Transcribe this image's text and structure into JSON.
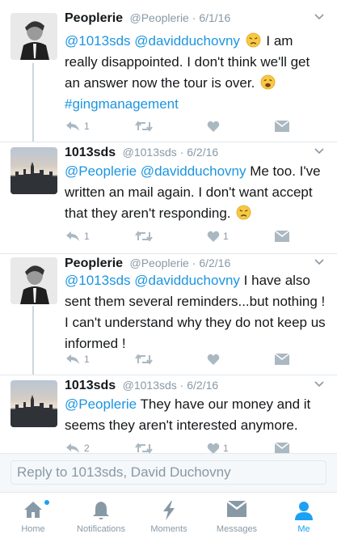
{
  "tweets": [
    {
      "name": "Peoplerie",
      "handle": "@Peoplerie",
      "date": "6/1/16",
      "avatar_icon": "man-portrait-avatar",
      "body_parts": [
        {
          "text": "@1013sds @davidduchovny",
          "style": "mention"
        },
        {
          "emoji": "disappointed-face-emoji"
        },
        {
          "text": "I am really disappointed. I don't think we'll get an answer now the tour is over.",
          "style": "plain"
        },
        {
          "emoji": "weary-face-emoji"
        },
        {
          "text": "#gingmanagement",
          "style": "mention"
        }
      ],
      "reply_count": "1",
      "retweet_count": "",
      "like_count": ""
    },
    {
      "name": "1013sds",
      "handle": "@1013sds",
      "date": "6/2/16",
      "avatar_icon": "city-skyline-avatar",
      "body_parts": [
        {
          "text": "@Peoplerie @davidduchovny",
          "style": "mention"
        },
        {
          "text": "Me too. I've written an mail again. I don't want accept that they aren't responding.",
          "style": "plain"
        },
        {
          "emoji": "disappointed-face-emoji"
        }
      ],
      "reply_count": "1",
      "retweet_count": "",
      "like_count": "1"
    },
    {
      "name": "Peoplerie",
      "handle": "@Peoplerie",
      "date": "6/2/16",
      "avatar_icon": "man-portrait-avatar",
      "body_parts": [
        {
          "text": "@1013sds @davidduchovny",
          "style": "mention"
        },
        {
          "text": "I have also sent them several reminders...but nothing ! I can't understand why they do not keep us informed !",
          "style": "plain"
        }
      ],
      "reply_count": "1",
      "retweet_count": "",
      "like_count": ""
    },
    {
      "name": "1013sds",
      "handle": "@1013sds",
      "date": "6/2/16",
      "avatar_icon": "city-skyline-avatar",
      "body_parts": [
        {
          "text": "@Peoplerie",
          "style": "mention"
        },
        {
          "text": " They have our money and it seems they aren't interested anymore.",
          "style": "plain"
        }
      ],
      "reply_count": "2",
      "retweet_count": "",
      "like_count": "1"
    }
  ],
  "meta_separator": "·",
  "reply_bar": {
    "placeholder": "Reply to 1013sds, David Duchovny"
  },
  "tabs": [
    {
      "label": "Home",
      "icon": "home-icon",
      "active": false,
      "has_dot": true
    },
    {
      "label": "Notifications",
      "icon": "bell-icon",
      "active": false,
      "has_dot": false
    },
    {
      "label": "Moments",
      "icon": "lightning-icon",
      "active": false,
      "has_dot": false
    },
    {
      "label": "Messages",
      "icon": "envelope-icon",
      "active": false,
      "has_dot": false
    },
    {
      "label": "Me",
      "icon": "person-icon",
      "active": true,
      "has_dot": false
    }
  ],
  "colors": {
    "accent": "#1da1f2",
    "mention": "#1b95e0",
    "muted": "#8899a6",
    "text": "#14171a",
    "divider": "#e1e8ed"
  }
}
